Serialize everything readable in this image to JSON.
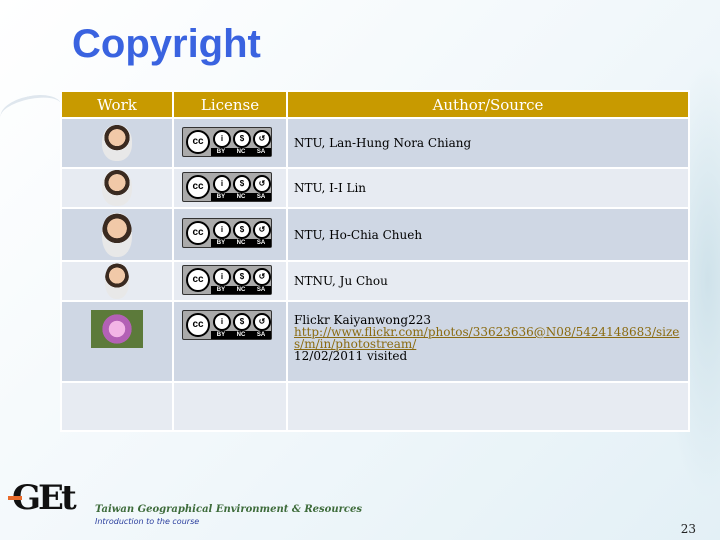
{
  "title": "Copyright",
  "table": {
    "headers": [
      "Work",
      "License",
      "Author/Source"
    ],
    "rows": [
      {
        "work": "portrait-photo",
        "license": "cc-by-nc-sa",
        "author": "NTU, Lan-Hung Nora Chiang"
      },
      {
        "work": "portrait-photo",
        "license": "cc-by-nc-sa",
        "author": "NTU, I-I Lin"
      },
      {
        "work": "portrait-photo",
        "license": "cc-by-nc-sa",
        "author": "NTU, Ho-Chia Chueh"
      },
      {
        "work": "portrait-photo",
        "license": "cc-by-nc-sa",
        "author": "NTNU, Ju Chou"
      },
      {
        "work": "flower-photo",
        "license": "cc-by-nc-sa",
        "author": "Flickr Kaiyanwong223",
        "link": "http://www.flickr.com/photos/33623636@N08/5424148683/sizes/m/in/photostream/",
        "visited": "12/02/2011 visited"
      }
    ]
  },
  "license_badge": {
    "cc": "cc",
    "labels": [
      "BY",
      "NC",
      "SA"
    ]
  },
  "footer": {
    "org": "Taiwan Geographical Environment & Resources",
    "subtitle": "Introduction to the course",
    "logo": "GEt",
    "page": "23"
  },
  "colors": {
    "title": "#3a63e0",
    "header": "#c89a00",
    "row_dark": "#cfd7e4",
    "row_light": "#e7ebf2"
  }
}
